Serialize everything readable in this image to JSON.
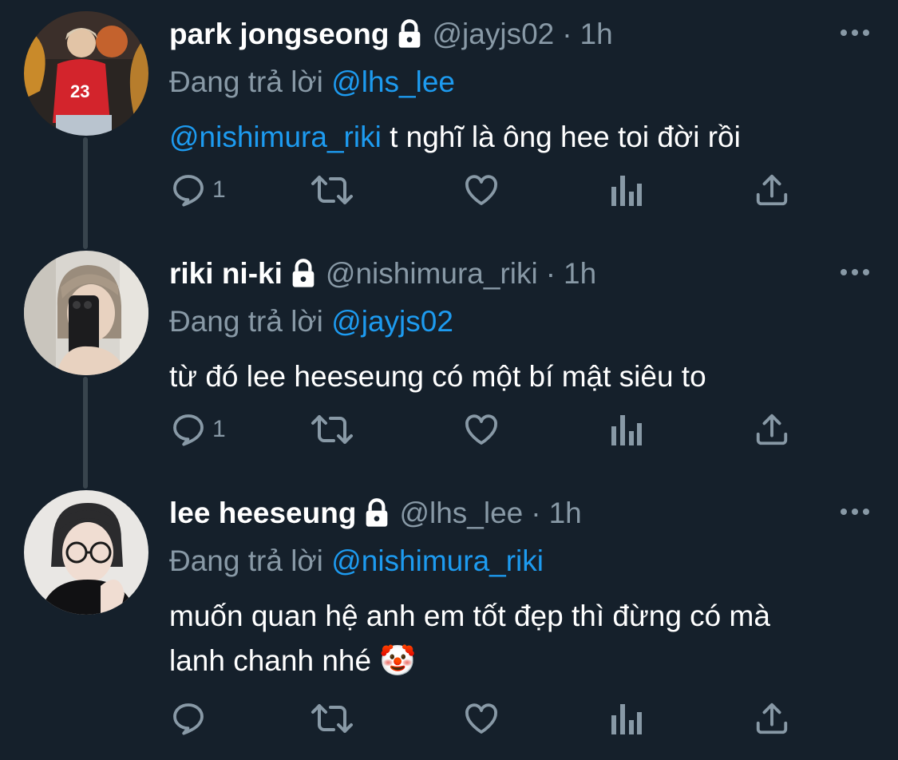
{
  "tweets": [
    {
      "display_name": "park jongseong",
      "handle": "@jayjs02",
      "time": "1h",
      "replying_prefix": "Đang trả lời",
      "replying_to": "@lhs_lee",
      "body_mention": "@nishimura_riki",
      "body_lines": [
        " t nghĩ là ông hee toi đời rồi"
      ],
      "reply_count": "1"
    },
    {
      "display_name": "riki ni-ki",
      "handle": "@nishimura_riki",
      "time": "1h",
      "replying_prefix": "Đang trả lời",
      "replying_to": "@jayjs02",
      "body_mention": "",
      "body_lines": [
        "từ đó lee heeseung có một bí mật siêu to"
      ],
      "reply_count": "1"
    },
    {
      "display_name": "lee heeseung",
      "handle": "@lhs_lee",
      "time": "1h",
      "replying_prefix": "Đang trả lời",
      "replying_to": "@nishimura_riki",
      "body_mention": "",
      "body_lines": [
        "muốn quan hệ anh em tốt đẹp thì đừng có mà",
        "lanh chanh nhé 🤡"
      ],
      "reply_count": ""
    }
  ],
  "separator": "·",
  "icons": {
    "lock": "lock-icon",
    "more": "more-icon",
    "reply": "reply-icon",
    "retweet": "retweet-icon",
    "like": "like-icon",
    "views": "views-icon",
    "share": "share-icon"
  },
  "colors": {
    "background": "#15202b",
    "text": "#ffffff",
    "secondary": "#8899a6",
    "link": "#1d9bf0",
    "thread_line": "#38444d"
  }
}
